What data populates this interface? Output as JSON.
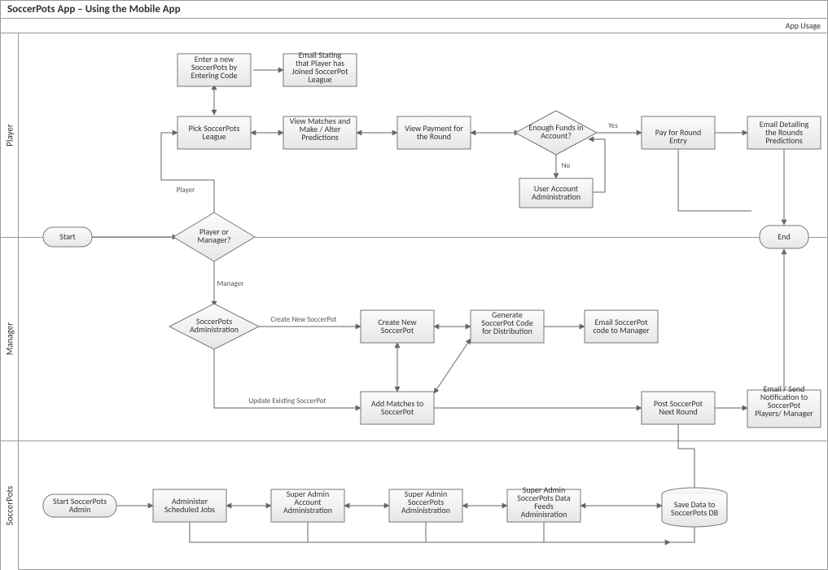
{
  "header": {
    "title": "SoccerPots App – Using the Mobile App",
    "subtitle": "App Usage"
  },
  "lanes": {
    "player": "Player",
    "manager": "Manager",
    "admin": "SoccerPots"
  },
  "nodes": {
    "start": "Start",
    "end": "End",
    "q_role": "Player or Manager?",
    "p_enterCode": "Enter a new SoccerPots by Entering Code",
    "p_emailJoin": "Email Stating that Player has Joined SoccerPot League",
    "p_pickLeague": "Pick SoccerPots League",
    "p_viewMatches": "View Matches and Make / Alter Predictions",
    "p_viewPay": "View Payment for the Round",
    "p_qFunds": "Enough Funds in Account?",
    "p_pay": "Pay for Round Entry",
    "p_emailRound": "Email Detailing the Rounds Predictions",
    "p_userAdmin": "User Account Administration",
    "m_qAdmin": "SoccerPots Administration",
    "m_createNew": "Create New SoccerPot",
    "m_genCode": "Generate SoccerPot Code for Distribution",
    "m_emailCode": "Email SoccerPot code to Manager",
    "m_addMatches": "Add Matches to SoccerPot",
    "m_postRound": "Post SoccerPot Next Round",
    "m_notify": "Email / Send Notification to SoccerPot Players/ Manager",
    "a_start": "Start SoccerPots Admin",
    "a_jobs": "Administer Scheduled Jobs",
    "a_acct": "Super Admin Account Administration",
    "a_sp": "Super Admin SoccerPots Administration",
    "a_feeds": "Super Admin SoccerPots Data Feeds Adminisration",
    "a_db": "Save Data to SoccerPots DB"
  },
  "edgeLabels": {
    "player": "Player",
    "manager": "Manager",
    "yes": "Yes",
    "no": "No",
    "createNew": "Create New SoccerPot",
    "updateExisting": "Update Existing SoccerPot"
  },
  "colors": {
    "nodeFillTop": "#fcfcfc",
    "nodeFillBot": "#e6e6e6",
    "stroke": "#777",
    "edge": "#666"
  }
}
